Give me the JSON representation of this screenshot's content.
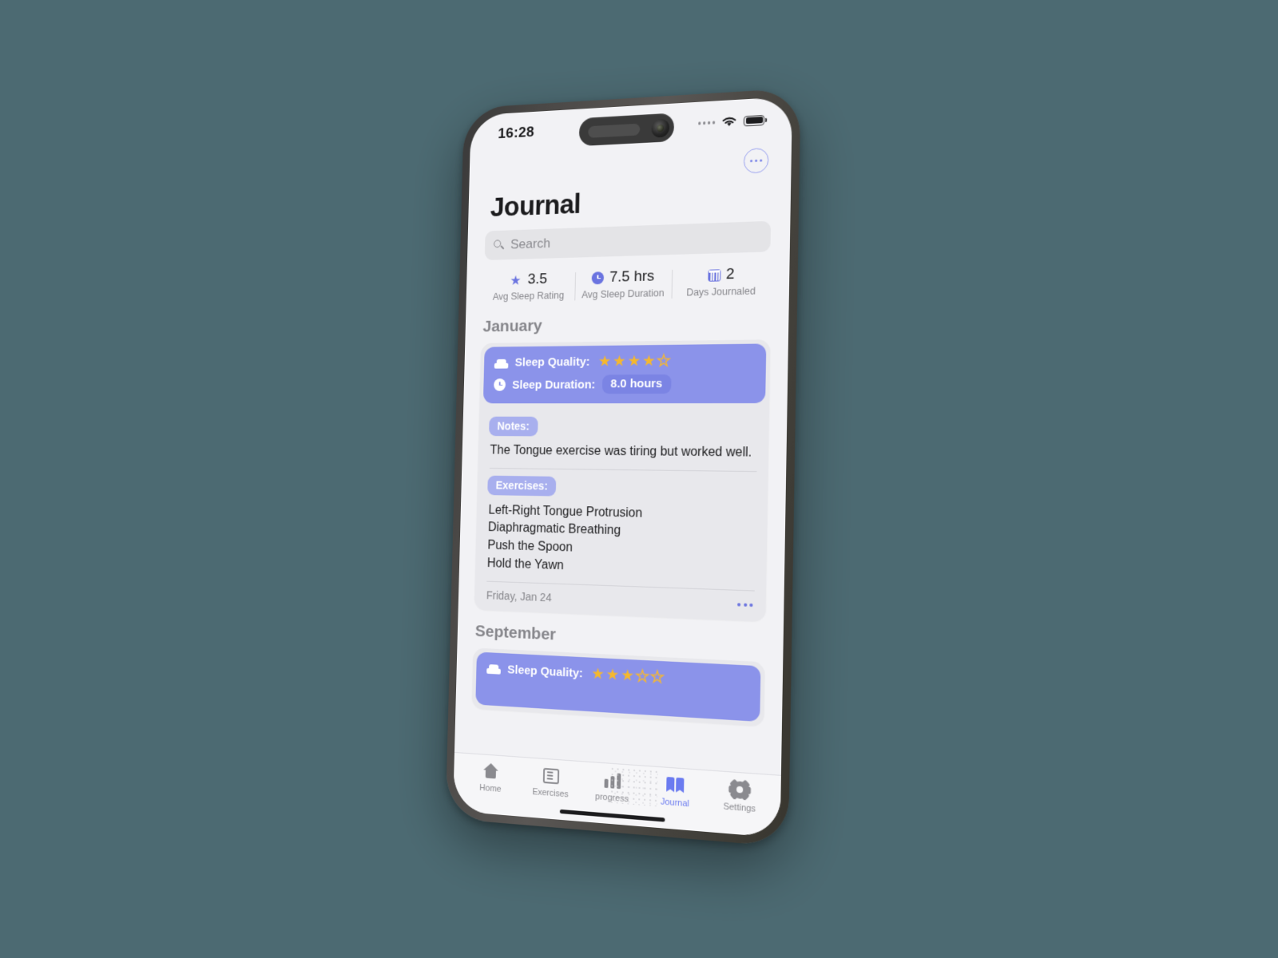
{
  "status_bar": {
    "time": "16:28",
    "signal_icon": "signal-dots-icon",
    "wifi_icon": "wifi-icon",
    "battery_icon": "battery-icon"
  },
  "nav": {
    "more_button_label": "•••",
    "more_icon": "ellipsis-icon"
  },
  "header": {
    "title": "Journal"
  },
  "search": {
    "placeholder": "Search",
    "value": "",
    "icon": "search-icon"
  },
  "stats": [
    {
      "icon": "star-icon",
      "value": "3.5",
      "label": "Avg Sleep Rating"
    },
    {
      "icon": "clock-icon",
      "value": "7.5 hrs",
      "label": "Avg Sleep Duration"
    },
    {
      "icon": "calendar-icon",
      "value": "2",
      "label": "Days Journaled"
    }
  ],
  "sections": [
    {
      "month": "January",
      "entry": {
        "sleep_quality_label": "Sleep Quality:",
        "sleep_quality_rating": 4,
        "sleep_quality_max": 5,
        "sleep_duration_label": "Sleep Duration:",
        "sleep_duration_value": "8.0 hours",
        "notes_label": "Notes:",
        "notes_text": "The Tongue exercise was tiring but worked well.",
        "exercises_label": "Exercises:",
        "exercises": [
          "Left-Right Tongue Protrusion",
          "Diaphragmatic Breathing",
          "Push the Spoon",
          "Hold the Yawn"
        ],
        "date": "Friday, Jan 24",
        "overflow_icon": "ellipsis-icon"
      }
    },
    {
      "month": "September",
      "entry": {
        "sleep_quality_label": "Sleep Quality:",
        "sleep_quality_rating": 3,
        "sleep_quality_max": 5
      }
    }
  ],
  "tabbar": {
    "items": [
      {
        "label": "Home",
        "icon": "home-icon",
        "active": false
      },
      {
        "label": "Exercises",
        "icon": "list-icon",
        "active": false
      },
      {
        "label": "progress",
        "icon": "bar-chart-icon",
        "active": false
      },
      {
        "label": "Journal",
        "icon": "book-icon",
        "active": true
      },
      {
        "label": "Settings",
        "icon": "gear-icon",
        "active": false
      }
    ]
  },
  "colors": {
    "accent": "#8b93ea",
    "accent_strong": "#6b74e0",
    "tab_active": "#6b7bf0",
    "star_filled": "#f5b82e",
    "card_bg": "#e8e8ec",
    "screen_bg": "#f2f2f5",
    "page_bg": "#4c6a72"
  }
}
